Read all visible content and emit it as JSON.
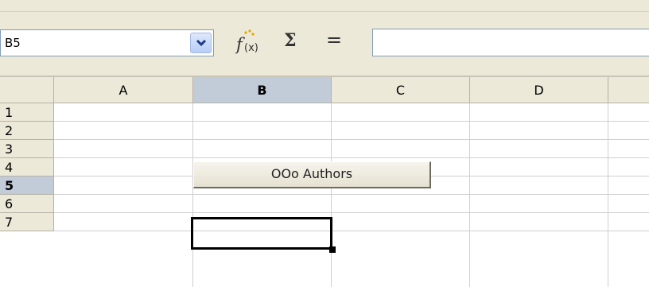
{
  "name_box": {
    "value": "B5"
  },
  "formula_bar": {
    "function_wizard_icon": "fx-icon",
    "sum_icon": "sigma-icon",
    "sum_symbol": "Σ",
    "function_icon": "equals-icon",
    "equals_symbol": "=",
    "input_value": ""
  },
  "columns": [
    {
      "label": "A",
      "active": false
    },
    {
      "label": "B",
      "active": true
    },
    {
      "label": "C",
      "active": false
    },
    {
      "label": "D",
      "active": false
    },
    {
      "label": "",
      "active": false
    }
  ],
  "rows": [
    "1",
    "2",
    "3",
    "4",
    "5",
    "6",
    "7"
  ],
  "active_row": "5",
  "active_cell": "B5",
  "form_button": {
    "label": "OOo Authors"
  },
  "colors": {
    "header_bg": "#ece9d8",
    "active_header_bg": "#c2ccd9",
    "grid_line": "#cfcfcf"
  }
}
